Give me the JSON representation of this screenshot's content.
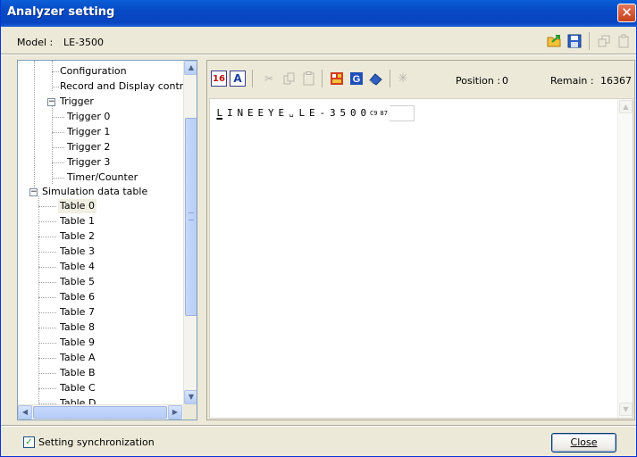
{
  "window": {
    "title": "Analyzer setting",
    "close_glyph": "✕"
  },
  "model": {
    "label": "Model :",
    "value": "LE-3500"
  },
  "tree": {
    "items": [
      {
        "label": "Configuration",
        "selected": false
      },
      {
        "label": "Record and Display control",
        "selected": false
      },
      {
        "label": "Trigger",
        "selected": false,
        "expander": "−"
      },
      {
        "label": "Trigger 0",
        "selected": false
      },
      {
        "label": "Trigger 1",
        "selected": false
      },
      {
        "label": "Trigger 2",
        "selected": false
      },
      {
        "label": "Trigger 3",
        "selected": false
      },
      {
        "label": "Timer/Counter",
        "selected": false
      },
      {
        "label": "Simulation data table",
        "selected": false,
        "expander": "−"
      },
      {
        "label": "Table 0",
        "selected": true
      },
      {
        "label": "Table 1",
        "selected": false
      },
      {
        "label": "Table 2",
        "selected": false
      },
      {
        "label": "Table 3",
        "selected": false
      },
      {
        "label": "Table 4",
        "selected": false
      },
      {
        "label": "Table 5",
        "selected": false
      },
      {
        "label": "Table 6",
        "selected": false
      },
      {
        "label": "Table 7",
        "selected": false
      },
      {
        "label": "Table 8",
        "selected": false
      },
      {
        "label": "Table 9",
        "selected": false
      },
      {
        "label": "Table A",
        "selected": false
      },
      {
        "label": "Table B",
        "selected": false
      },
      {
        "label": "Table C",
        "selected": false
      },
      {
        "label": "Table D",
        "selected": false
      }
    ]
  },
  "toolbar": {
    "hex_label": "16",
    "ascii_label": "A",
    "position_label": "Position :",
    "position_value": "0",
    "remain_label": "Remain :",
    "remain_value": "16367"
  },
  "editor": {
    "chars": [
      "L",
      "I",
      "N",
      "E",
      "E",
      "Y",
      "E",
      "␣",
      "L",
      "E",
      "-",
      "3",
      "5",
      "0",
      "0",
      "C9",
      "87"
    ]
  },
  "footer": {
    "sync_label": "Setting synchronization",
    "sync_checked": true,
    "close_label_underlined": "C",
    "close_label_rest": "lose"
  },
  "colors": {
    "titlebar": "#0849c4",
    "close": "#c8401b",
    "selection": "#f1efe2"
  }
}
